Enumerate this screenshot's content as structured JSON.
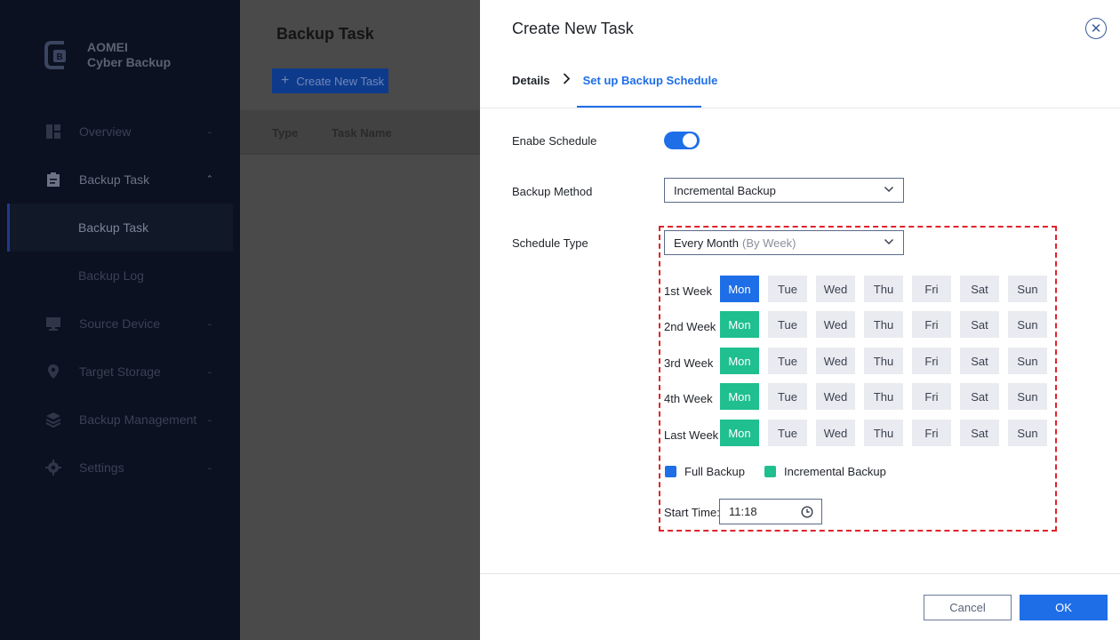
{
  "app": {
    "name_line1": "AOMEI",
    "name_line2": "Cyber Backup"
  },
  "sidebar": {
    "items": [
      {
        "label": "Overview",
        "icon": "dashboard-icon"
      },
      {
        "label": "Backup Task",
        "icon": "clipboard-icon"
      },
      {
        "label": "Backup Task",
        "sub": true
      },
      {
        "label": "Backup Log",
        "sub": true
      },
      {
        "label": "Source Device",
        "icon": "monitor-icon"
      },
      {
        "label": "Target Storage",
        "icon": "location-pin-icon"
      },
      {
        "label": "Backup Management",
        "icon": "layers-icon"
      },
      {
        "label": "Settings",
        "icon": "gear-icon"
      }
    ]
  },
  "main": {
    "title": "Backup Task",
    "create_button": "Create New Task",
    "columns": [
      "Type",
      "Task Name"
    ]
  },
  "panel": {
    "title": "Create New Task",
    "steps": {
      "details": "Details",
      "schedule": "Set up Backup Schedule"
    },
    "enable_schedule_label": "Enabe Schedule",
    "enable_schedule_on": true,
    "backup_method_label": "Backup Method",
    "backup_method_value": "Incremental Backup",
    "schedule_type_label": "Schedule Type",
    "schedule_type_value": "Every Month",
    "schedule_type_hint": "(By Week)",
    "weeks": [
      {
        "label": "1st Week",
        "selected": "full"
      },
      {
        "label": "2nd Week",
        "selected": "inc"
      },
      {
        "label": "3rd Week",
        "selected": "inc"
      },
      {
        "label": "4th Week",
        "selected": "inc"
      },
      {
        "label": "Last Week",
        "selected": "inc"
      }
    ],
    "days": [
      "Mon",
      "Tue",
      "Wed",
      "Thu",
      "Fri",
      "Sat",
      "Sun"
    ],
    "legend": {
      "full": "Full Backup",
      "incremental": "Incremental Backup"
    },
    "start_time_label": "Start Time:",
    "start_time_value": "11:18",
    "cancel_button": "Cancel",
    "ok_button": "OK"
  },
  "colors": {
    "accent": "#1e6ee8",
    "incremental": "#1fbf8f",
    "highlight_border": "#e0222a"
  }
}
